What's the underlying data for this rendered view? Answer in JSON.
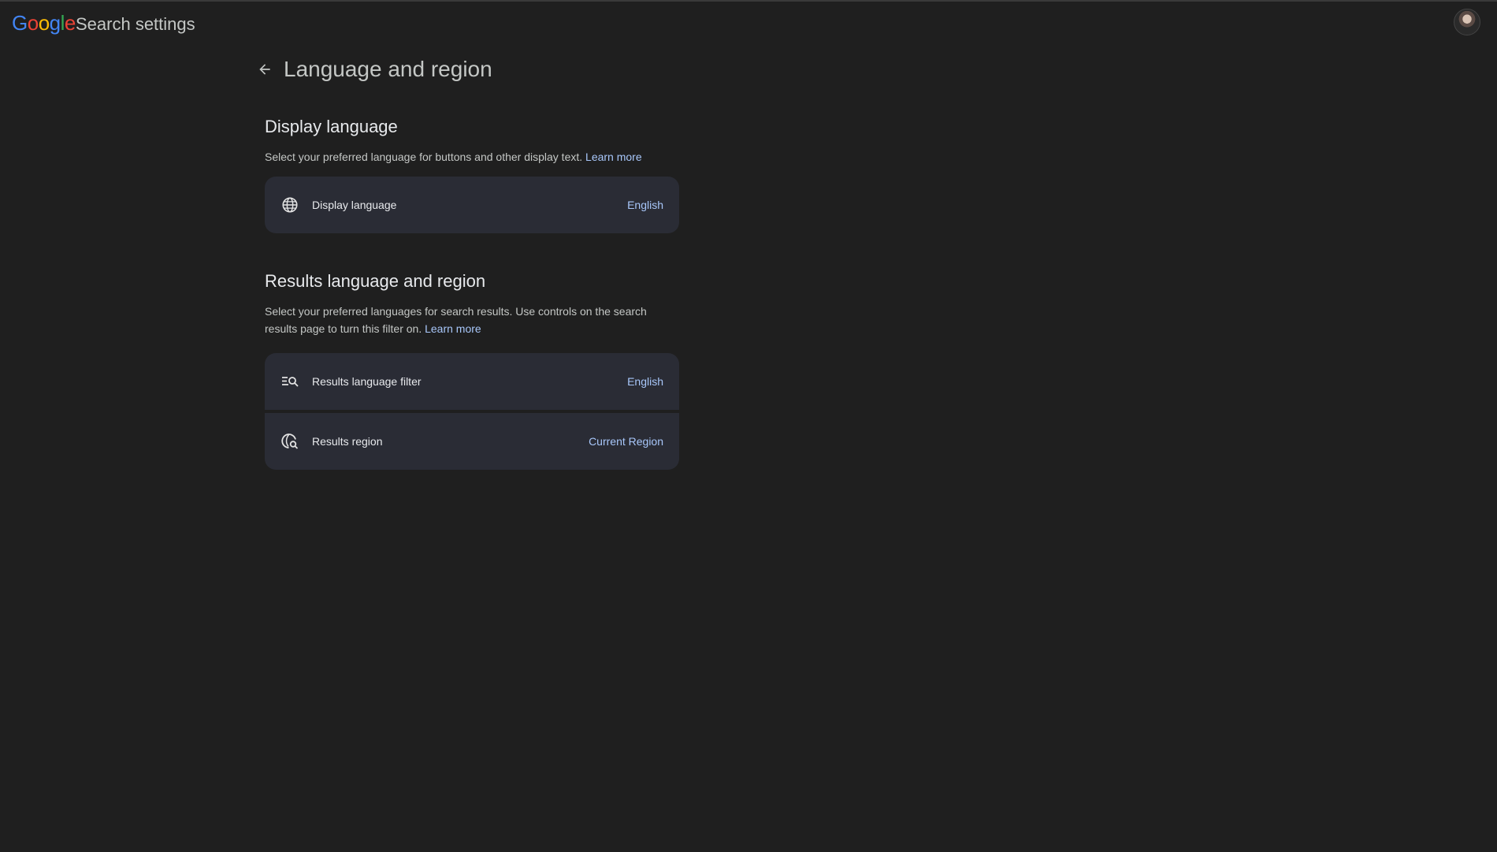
{
  "header": {
    "logo_letters": [
      {
        "char": "G",
        "color": "#4285F4"
      },
      {
        "char": "o",
        "color": "#EA4335"
      },
      {
        "char": "o",
        "color": "#FBBC05"
      },
      {
        "char": "g",
        "color": "#4285F4"
      },
      {
        "char": "l",
        "color": "#34A853"
      },
      {
        "char": "e",
        "color": "#EA4335"
      }
    ],
    "app_title": "Search settings",
    "avatar_icon": "account-avatar"
  },
  "page": {
    "back_icon": "arrow-back-icon",
    "title": "Language and region"
  },
  "display_section": {
    "heading": "Display language",
    "description": "Select your preferred language for buttons and other display text.",
    "learn_more": "Learn more",
    "rows": [
      {
        "icon": "globe-icon",
        "label": "Display language",
        "value": "English"
      }
    ]
  },
  "results_section": {
    "heading": "Results language and region",
    "description": "Select your preferred languages for search results. Use controls on the search results page to turn this filter on.",
    "learn_more": "Learn more",
    "rows": [
      {
        "icon": "filter-search-icon",
        "label": "Results language filter",
        "value": "English"
      },
      {
        "icon": "region-search-icon",
        "label": "Results region",
        "value": "Current Region"
      }
    ]
  },
  "colors": {
    "background": "#1f1f1f",
    "card": "#2a2c35",
    "link": "#a8c7fa"
  }
}
